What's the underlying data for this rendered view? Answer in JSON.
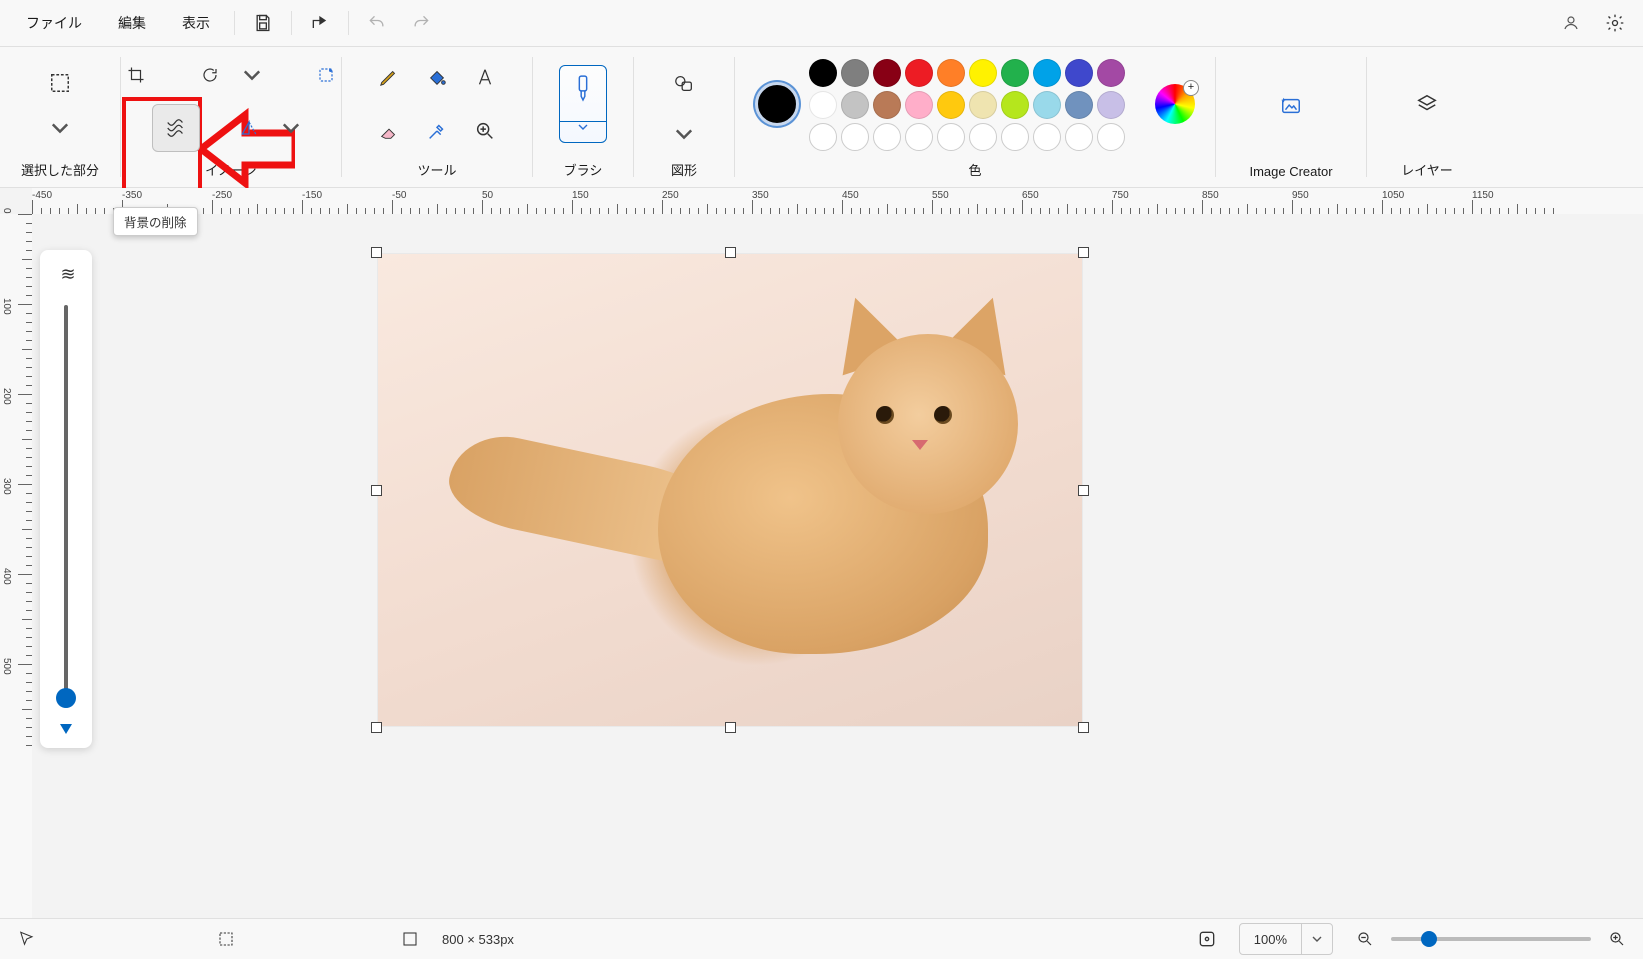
{
  "menu": {
    "file": "ファイル",
    "edit": "編集",
    "view": "表示"
  },
  "ribbon": {
    "selection_label": "選択した部分",
    "image_label": "イメージ",
    "tools_label": "ツール",
    "brush_label": "ブラシ",
    "shapes_label": "図形",
    "color_label": "色",
    "image_creator_label": "Image Creator",
    "layers_label": "レイヤー"
  },
  "tooltip": {
    "remove_bg": "背景の削除"
  },
  "palette": {
    "current": "#000000",
    "row1": [
      "#000000",
      "#7f7f7f",
      "#880015",
      "#ed1c24",
      "#ff7f27",
      "#fff200",
      "#22b14c",
      "#00a2e8",
      "#3f48cc",
      "#a349a4"
    ],
    "row2": [
      "#ffffff",
      "#c3c3c3",
      "#b97a57",
      "#ffaec9",
      "#ffc90e",
      "#efe4b0",
      "#b5e61d",
      "#99d9ea",
      "#7092be",
      "#c8bfe7"
    ],
    "row3_empty_count": 10
  },
  "ruler_h": {
    "start": -450,
    "end": 1150,
    "major_step": 100
  },
  "ruler_v": {
    "start": 0,
    "end": 550,
    "major_step": 100
  },
  "status": {
    "cursor_coords": "",
    "canvas_size": "800 × 533px",
    "zoom": "100%"
  }
}
